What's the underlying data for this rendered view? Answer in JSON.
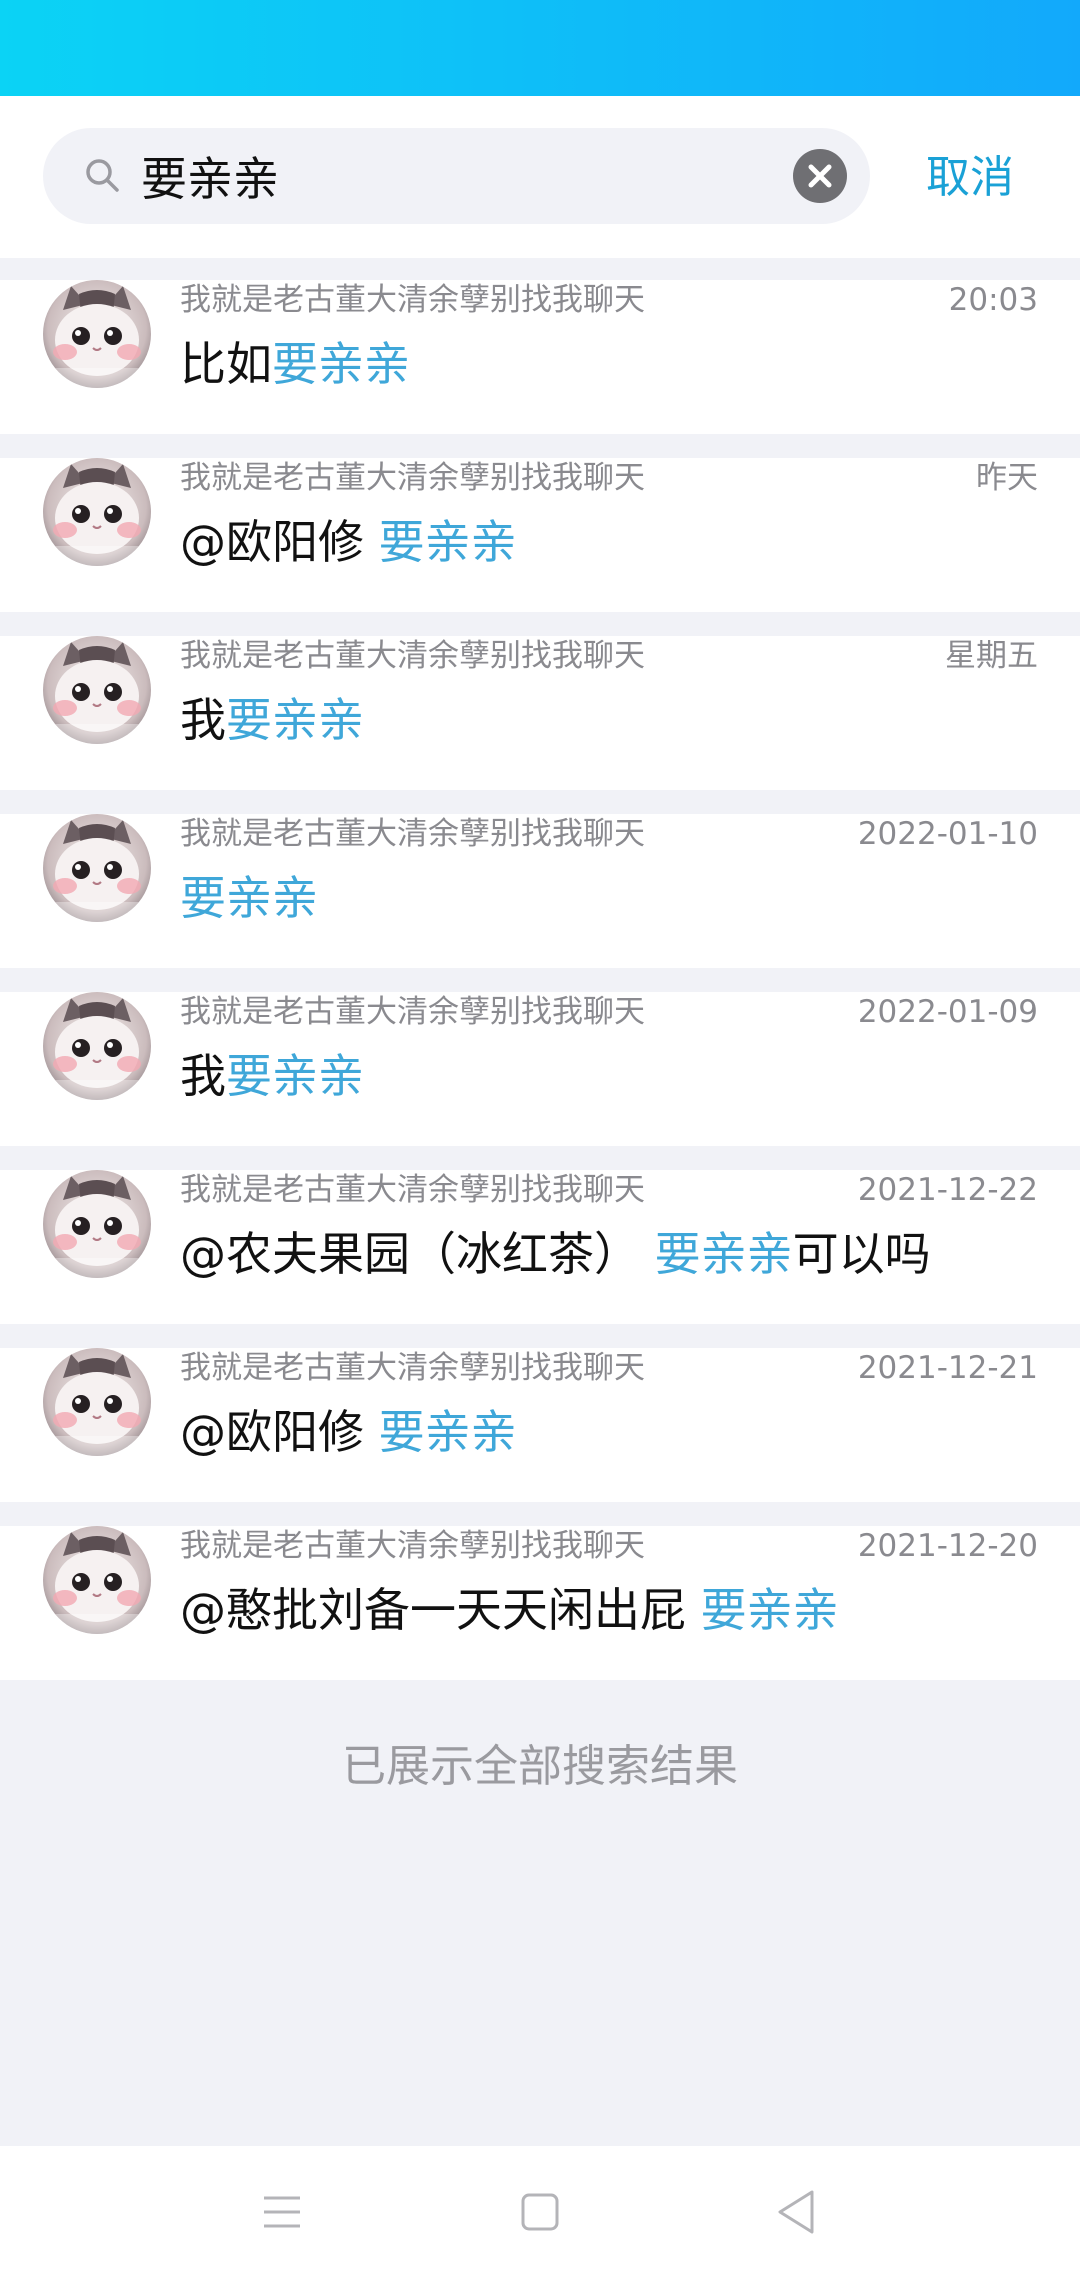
{
  "search": {
    "query": "要亲亲",
    "cancel_label": "取消"
  },
  "results": [
    {
      "sender": "我就是老古董大清余孽别找我聊天",
      "time": "20:03",
      "prefix": "比如",
      "highlight": "要亲亲",
      "suffix": ""
    },
    {
      "sender": "我就是老古董大清余孽别找我聊天",
      "time": "昨天",
      "prefix": "@欧阳修 ",
      "highlight": "要亲亲",
      "suffix": ""
    },
    {
      "sender": "我就是老古董大清余孽别找我聊天",
      "time": "星期五",
      "prefix": "我",
      "highlight": "要亲亲",
      "suffix": ""
    },
    {
      "sender": "我就是老古董大清余孽别找我聊天",
      "time": "2022-01-10",
      "prefix": "",
      "highlight": "要亲亲",
      "suffix": ""
    },
    {
      "sender": "我就是老古董大清余孽别找我聊天",
      "time": "2022-01-09",
      "prefix": "我",
      "highlight": "要亲亲",
      "suffix": ""
    },
    {
      "sender": "我就是老古董大清余孽别找我聊天",
      "time": "2021-12-22",
      "prefix": "@农夫果园（冰红茶） ",
      "highlight": "要亲亲",
      "suffix": "可以吗"
    },
    {
      "sender": "我就是老古董大清余孽别找我聊天",
      "time": "2021-12-21",
      "prefix": "@欧阳修 ",
      "highlight": "要亲亲",
      "suffix": ""
    },
    {
      "sender": "我就是老古董大清余孽别找我聊天",
      "time": "2021-12-20",
      "prefix": "@憨批刘备一天天闲出屁 ",
      "highlight": "要亲亲",
      "suffix": ""
    }
  ],
  "footer_note": "已展示全部搜索结果",
  "colors": {
    "accent": "#1aa1d6",
    "highlight": "#3fa7d9",
    "status_bar_start": "#0bd3f5",
    "status_bar_end": "#12a9fb"
  },
  "icons": {
    "search": "search-icon",
    "clear": "clear-icon",
    "avatar": "cat-avatar",
    "nav_menu": "menu-icon",
    "nav_home": "home-icon",
    "nav_back": "back-icon"
  }
}
